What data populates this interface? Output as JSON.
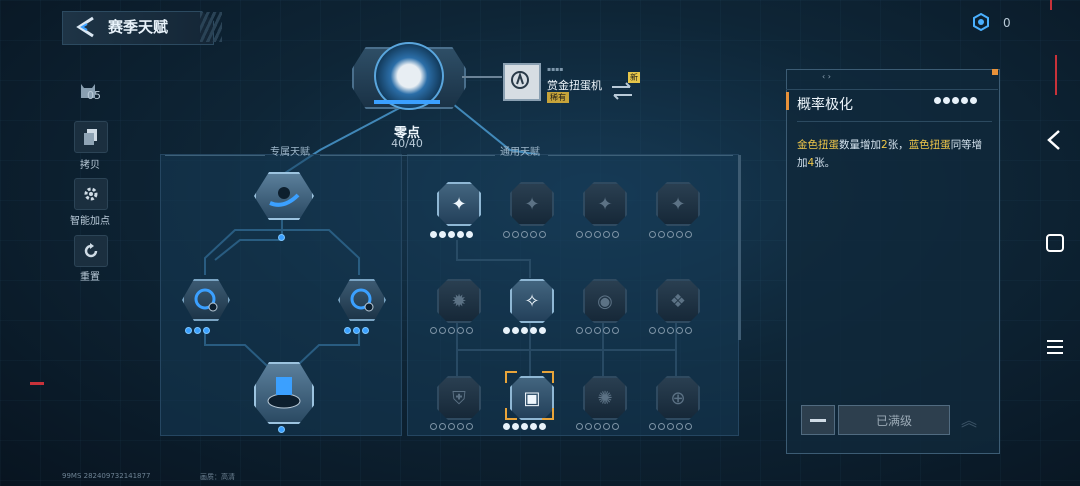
{
  "header": {
    "title": "赛季天赋"
  },
  "currency": {
    "value": "0"
  },
  "sidebar": {
    "level": "05",
    "items": [
      {
        "label": "拷贝"
      },
      {
        "label": "智能加点"
      },
      {
        "label": "重置"
      }
    ]
  },
  "core": {
    "name": "零点",
    "level": "40/40"
  },
  "card": {
    "name": "赏金扭蛋机",
    "tag": "稀有",
    "new_badge": "新"
  },
  "sections": {
    "exclusive": "专属天赋",
    "general": "通用天赋"
  },
  "detail": {
    "title": "概率极化",
    "desc_parts": [
      "金色扭蛋",
      "数量增加",
      "2",
      "张，",
      "蓝色扭蛋",
      "同等增加",
      "4",
      "张。"
    ],
    "max_label": "已满级",
    "level_filled": 5,
    "level_total": 5
  },
  "footer": {
    "left": "99MS  282409732141877",
    "right": "画质：高清"
  },
  "colors": {
    "accent": "#f0c84a",
    "selection": "#e8a43a",
    "active_dot": "#3ba0ff"
  }
}
